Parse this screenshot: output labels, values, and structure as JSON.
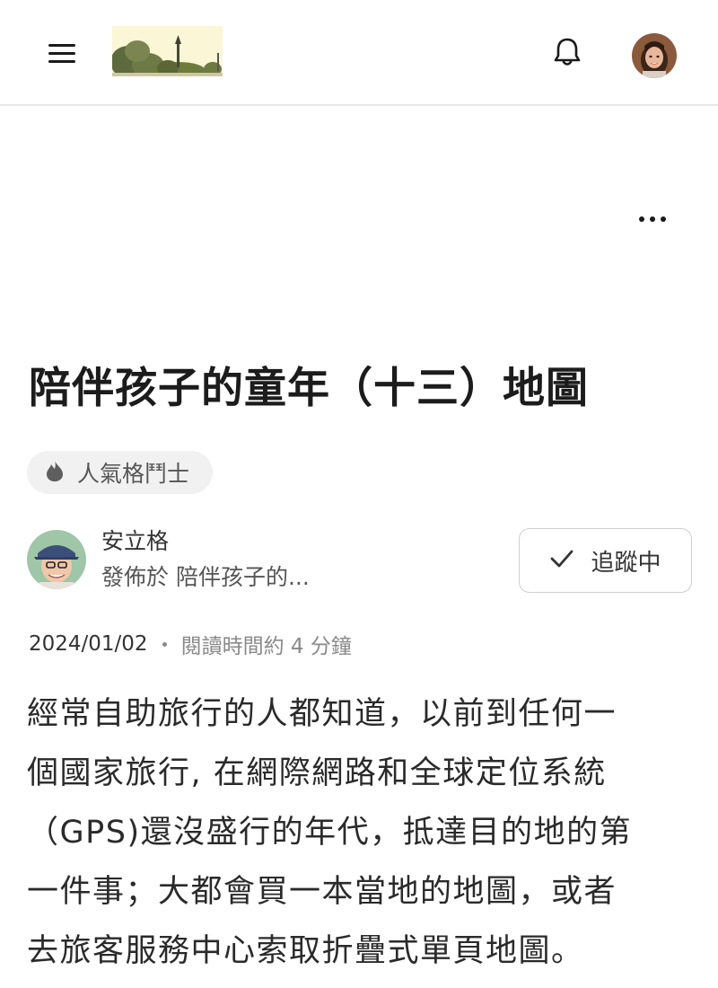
{
  "header": {
    "menu_icon": "hamburger-menu-icon",
    "logo_alt": "site-logo-image",
    "bell_icon": "bell-icon",
    "user_avatar": "user-avatar-image"
  },
  "post": {
    "more_icon": "more-horizontal-icon",
    "title": "陪伴孩子的童年（十三）地圖",
    "badge": {
      "icon": "flame-icon",
      "label": "人氣格鬥士"
    },
    "author": {
      "name": "安立格",
      "published_in": "發佈於 陪伴孩子的..."
    },
    "follow_button": {
      "icon": "checkmark-icon",
      "label": "追蹤中"
    },
    "meta": {
      "date": "2024/01/02",
      "read_time": "閱讀時間約 4 分鐘"
    },
    "body_lines": [
      "經常自助旅行的人都知道，以前到任何一",
      "個國家旅行, 在網際網路和全球定位系統",
      "（GPS)還沒盛行的年代，抵達目的地的第",
      "一件事；大都會買一本當地的地圖，或者",
      "去旅客服務中心索取折疊式單頁地圖。"
    ]
  }
}
